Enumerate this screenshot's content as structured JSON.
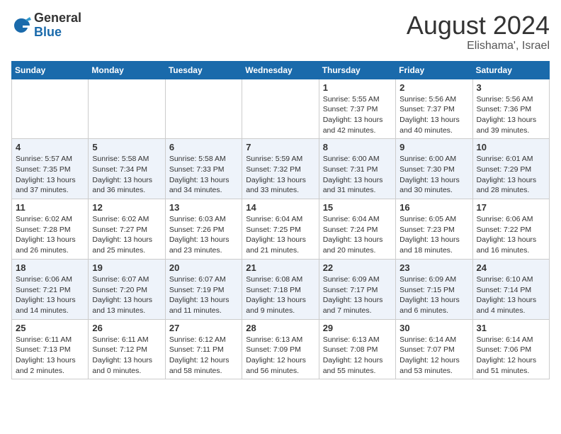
{
  "logo": {
    "general": "General",
    "blue": "Blue"
  },
  "title": {
    "month_year": "August 2024",
    "location": "Elishama', Israel"
  },
  "weekdays": [
    "Sunday",
    "Monday",
    "Tuesday",
    "Wednesday",
    "Thursday",
    "Friday",
    "Saturday"
  ],
  "weeks": [
    [
      {
        "day": "",
        "info": ""
      },
      {
        "day": "",
        "info": ""
      },
      {
        "day": "",
        "info": ""
      },
      {
        "day": "",
        "info": ""
      },
      {
        "day": "1",
        "info": "Sunrise: 5:55 AM\nSunset: 7:37 PM\nDaylight: 13 hours and 42 minutes."
      },
      {
        "day": "2",
        "info": "Sunrise: 5:56 AM\nSunset: 7:37 PM\nDaylight: 13 hours and 40 minutes."
      },
      {
        "day": "3",
        "info": "Sunrise: 5:56 AM\nSunset: 7:36 PM\nDaylight: 13 hours and 39 minutes."
      }
    ],
    [
      {
        "day": "4",
        "info": "Sunrise: 5:57 AM\nSunset: 7:35 PM\nDaylight: 13 hours and 37 minutes."
      },
      {
        "day": "5",
        "info": "Sunrise: 5:58 AM\nSunset: 7:34 PM\nDaylight: 13 hours and 36 minutes."
      },
      {
        "day": "6",
        "info": "Sunrise: 5:58 AM\nSunset: 7:33 PM\nDaylight: 13 hours and 34 minutes."
      },
      {
        "day": "7",
        "info": "Sunrise: 5:59 AM\nSunset: 7:32 PM\nDaylight: 13 hours and 33 minutes."
      },
      {
        "day": "8",
        "info": "Sunrise: 6:00 AM\nSunset: 7:31 PM\nDaylight: 13 hours and 31 minutes."
      },
      {
        "day": "9",
        "info": "Sunrise: 6:00 AM\nSunset: 7:30 PM\nDaylight: 13 hours and 30 minutes."
      },
      {
        "day": "10",
        "info": "Sunrise: 6:01 AM\nSunset: 7:29 PM\nDaylight: 13 hours and 28 minutes."
      }
    ],
    [
      {
        "day": "11",
        "info": "Sunrise: 6:02 AM\nSunset: 7:28 PM\nDaylight: 13 hours and 26 minutes."
      },
      {
        "day": "12",
        "info": "Sunrise: 6:02 AM\nSunset: 7:27 PM\nDaylight: 13 hours and 25 minutes."
      },
      {
        "day": "13",
        "info": "Sunrise: 6:03 AM\nSunset: 7:26 PM\nDaylight: 13 hours and 23 minutes."
      },
      {
        "day": "14",
        "info": "Sunrise: 6:04 AM\nSunset: 7:25 PM\nDaylight: 13 hours and 21 minutes."
      },
      {
        "day": "15",
        "info": "Sunrise: 6:04 AM\nSunset: 7:24 PM\nDaylight: 13 hours and 20 minutes."
      },
      {
        "day": "16",
        "info": "Sunrise: 6:05 AM\nSunset: 7:23 PM\nDaylight: 13 hours and 18 minutes."
      },
      {
        "day": "17",
        "info": "Sunrise: 6:06 AM\nSunset: 7:22 PM\nDaylight: 13 hours and 16 minutes."
      }
    ],
    [
      {
        "day": "18",
        "info": "Sunrise: 6:06 AM\nSunset: 7:21 PM\nDaylight: 13 hours and 14 minutes."
      },
      {
        "day": "19",
        "info": "Sunrise: 6:07 AM\nSunset: 7:20 PM\nDaylight: 13 hours and 13 minutes."
      },
      {
        "day": "20",
        "info": "Sunrise: 6:07 AM\nSunset: 7:19 PM\nDaylight: 13 hours and 11 minutes."
      },
      {
        "day": "21",
        "info": "Sunrise: 6:08 AM\nSunset: 7:18 PM\nDaylight: 13 hours and 9 minutes."
      },
      {
        "day": "22",
        "info": "Sunrise: 6:09 AM\nSunset: 7:17 PM\nDaylight: 13 hours and 7 minutes."
      },
      {
        "day": "23",
        "info": "Sunrise: 6:09 AM\nSunset: 7:15 PM\nDaylight: 13 hours and 6 minutes."
      },
      {
        "day": "24",
        "info": "Sunrise: 6:10 AM\nSunset: 7:14 PM\nDaylight: 13 hours and 4 minutes."
      }
    ],
    [
      {
        "day": "25",
        "info": "Sunrise: 6:11 AM\nSunset: 7:13 PM\nDaylight: 13 hours and 2 minutes."
      },
      {
        "day": "26",
        "info": "Sunrise: 6:11 AM\nSunset: 7:12 PM\nDaylight: 13 hours and 0 minutes."
      },
      {
        "day": "27",
        "info": "Sunrise: 6:12 AM\nSunset: 7:11 PM\nDaylight: 12 hours and 58 minutes."
      },
      {
        "day": "28",
        "info": "Sunrise: 6:13 AM\nSunset: 7:09 PM\nDaylight: 12 hours and 56 minutes."
      },
      {
        "day": "29",
        "info": "Sunrise: 6:13 AM\nSunset: 7:08 PM\nDaylight: 12 hours and 55 minutes."
      },
      {
        "day": "30",
        "info": "Sunrise: 6:14 AM\nSunset: 7:07 PM\nDaylight: 12 hours and 53 minutes."
      },
      {
        "day": "31",
        "info": "Sunrise: 6:14 AM\nSunset: 7:06 PM\nDaylight: 12 hours and 51 minutes."
      }
    ]
  ]
}
